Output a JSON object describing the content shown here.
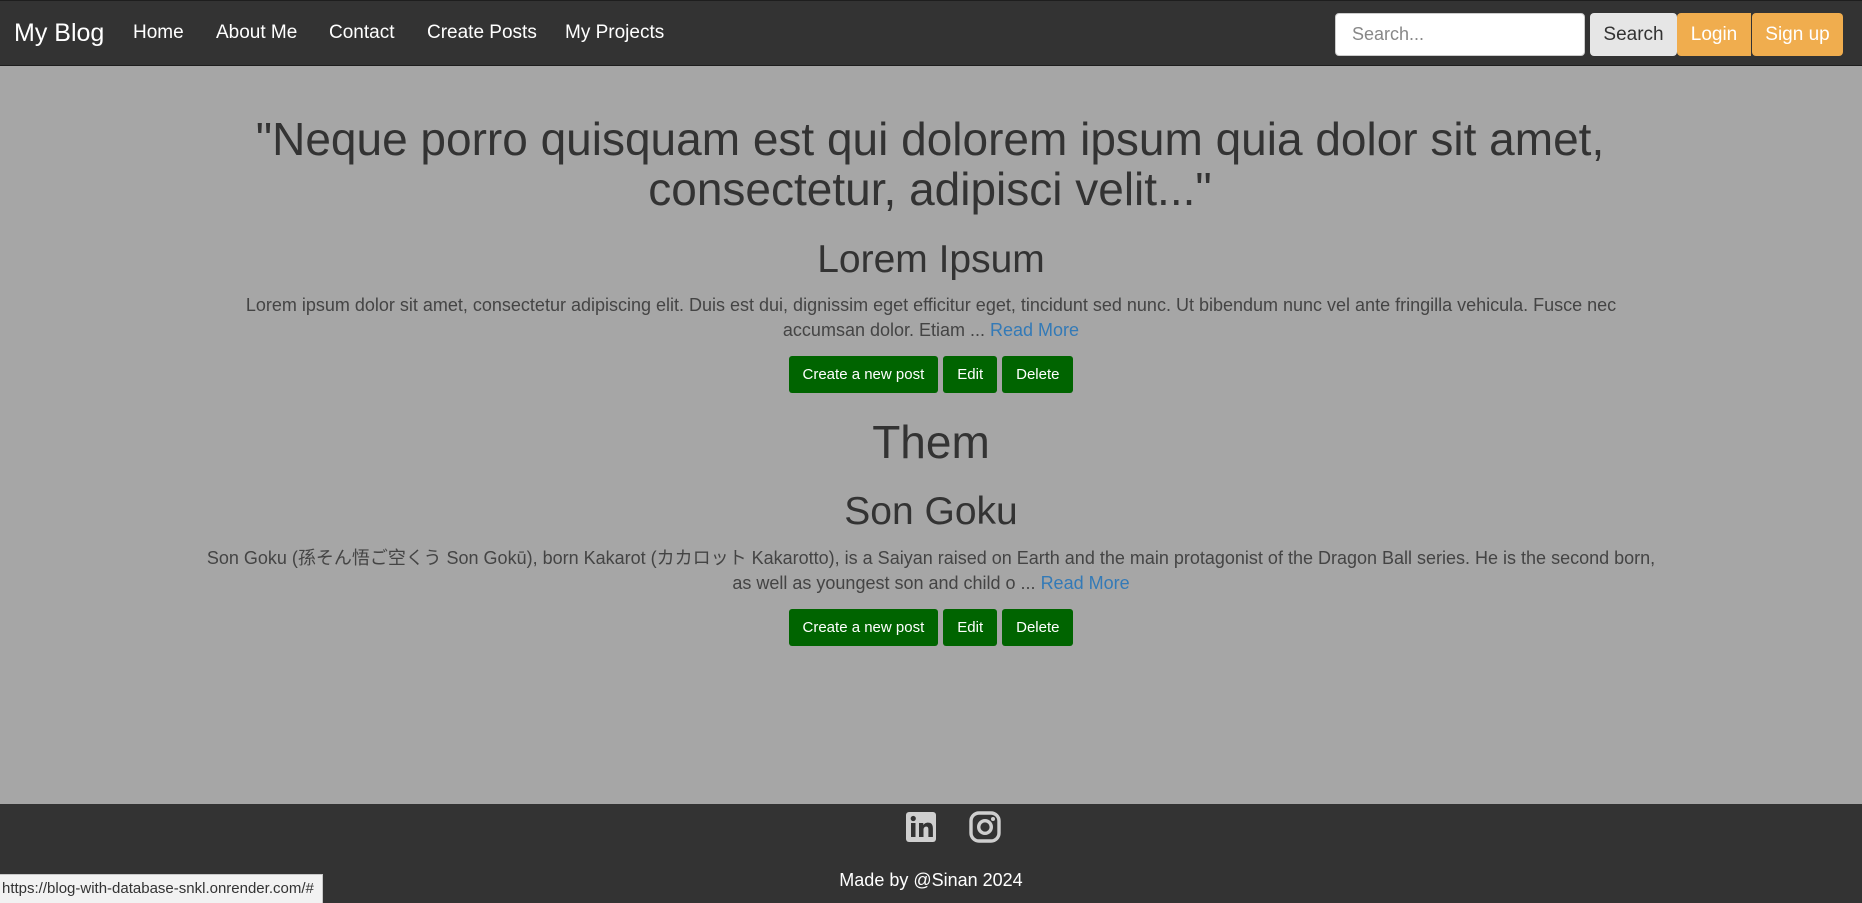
{
  "navbar": {
    "brand": "My Blog",
    "links": [
      "Home",
      "About Me",
      "Contact",
      "Create Posts",
      "My Projects"
    ],
    "search_placeholder": "Search...",
    "search_label": "Search",
    "login_label": "Login",
    "signup_label": "Sign up"
  },
  "main": {
    "quote": "\"Neque porro quisquam est qui dolorem ipsum quia dolor sit amet, consectetur, adipisci velit...\"",
    "section_title": "Them",
    "posts": [
      {
        "title": "Lorem Ipsum",
        "excerpt": "Lorem ipsum dolor sit amet, consectetur adipiscing elit. Duis est dui, dignissim eget efficitur eget, tincidunt sed nunc. Ut bibendum nunc vel ante fringilla vehicula. Fusce nec accumsan dolor. Etiam ... ",
        "read_more": "Read More"
      },
      {
        "title": "Son Goku",
        "excerpt": "Son Goku (孫そん悟ご空くう Son Gokū), born Kakarot (カカロット Kakarotto), is a Saiyan raised on Earth and the main protagonist of the Dragon Ball series. He is the second born, as well as youngest son and child o ... ",
        "read_more": "Read More"
      }
    ],
    "actions": {
      "create": "Create a new post",
      "edit": "Edit",
      "delete": "Delete"
    }
  },
  "footer": {
    "icons": [
      "linkedin-icon",
      "instagram-icon"
    ],
    "made_by": "Made by @Sinan 2024"
  },
  "status_bar": {
    "url": "https://blog-with-database-snkl.onrender.com/#"
  },
  "colors": {
    "navbar_bg": "#333333",
    "page_bg": "#a6a6a6",
    "accent_orange": "#f0ad4e",
    "action_green": "#006400",
    "link_blue": "#337ab7"
  }
}
